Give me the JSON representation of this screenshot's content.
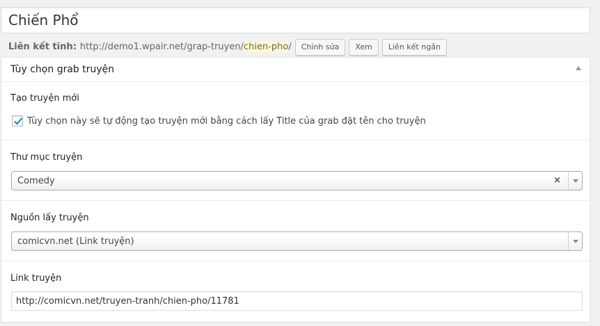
{
  "post_title": "Chiến Phổ",
  "permalink": {
    "label": "Liên kết tĩnh:",
    "base": "http://demo1.wpair.net/grap-truyen/",
    "slug": "chien-pho",
    "trail": "/",
    "edit_label": "Chỉnh sửa",
    "view_label": "Xem",
    "shortlink_label": "Liên kết ngắn"
  },
  "metabox": {
    "title": "Tùy chọn grab truyện",
    "toggle_icon": "triangle-up-icon",
    "create_new": {
      "label": "Tạo truyện mới",
      "checkbox_text": "Tùy chọn này sẽ tự động tạo truyện mới bằng cách lấy Title của grab đặt tên cho truyện",
      "checked": true
    },
    "folder": {
      "label": "Thư mục truyện",
      "selected": "Comedy",
      "clear": "×"
    },
    "source": {
      "label": "Nguồn lấy truyện",
      "selected": "comicvn.net (Link truyện)"
    },
    "link": {
      "label": "Link truyện",
      "value": "http://comicvn.net/truyen-tranh/chien-pho/11781"
    }
  },
  "colors": {
    "checkmark": "#1e8cbe",
    "slug_highlight": "#fffbcc"
  }
}
